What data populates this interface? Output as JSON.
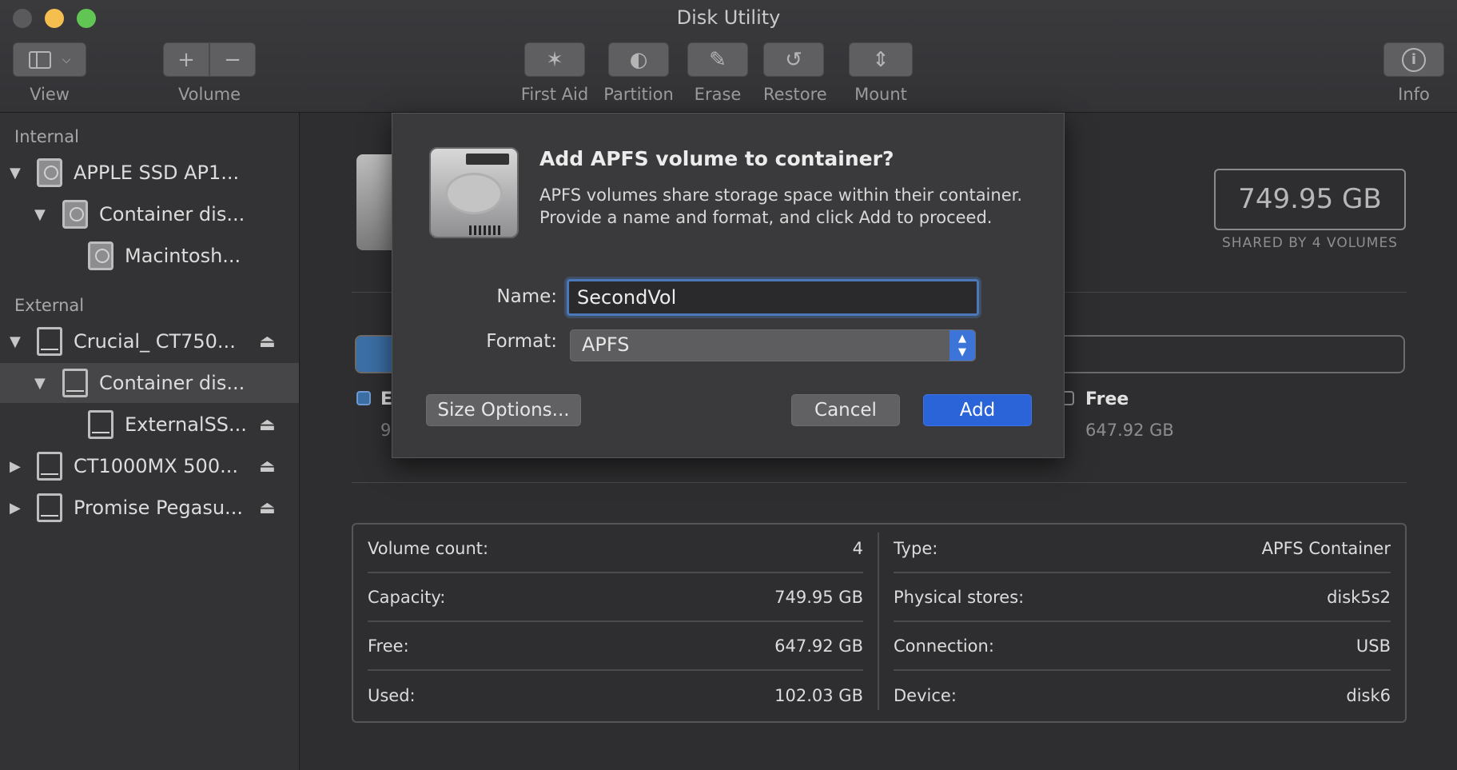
{
  "window": {
    "title": "Disk Utility"
  },
  "toolbar": {
    "view_label": "View",
    "volume_label": "Volume",
    "first_aid_label": "First Aid",
    "partition_label": "Partition",
    "erase_label": "Erase",
    "restore_label": "Restore",
    "mount_label": "Mount",
    "info_label": "Info"
  },
  "sidebar": {
    "internal_header": "Internal",
    "external_header": "External",
    "items": [
      {
        "label": "APPLE SSD AP1..."
      },
      {
        "label": "Container dis..."
      },
      {
        "label": "Macintosh..."
      },
      {
        "label": "Crucial_ CT750..."
      },
      {
        "label": "Container dis..."
      },
      {
        "label": "ExternalSS..."
      },
      {
        "label": "CT1000MX 500..."
      },
      {
        "label": "Promise Pegasu..."
      }
    ]
  },
  "main": {
    "capacity": "749.95 GB",
    "capacity_sub": "SHARED BY 4 VOLUMES",
    "used_fraction": 0.136,
    "legend_used_name": "E",
    "legend_used_value": "9",
    "legend_free_name": "Free",
    "legend_free_value": "647.92 GB",
    "info_left": [
      {
        "label": "Volume count:",
        "value": "4"
      },
      {
        "label": "Capacity:",
        "value": "749.95 GB"
      },
      {
        "label": "Free:",
        "value": "647.92 GB"
      },
      {
        "label": "Used:",
        "value": "102.03 GB"
      }
    ],
    "info_right": [
      {
        "label": "Type:",
        "value": "APFS Container"
      },
      {
        "label": "Physical stores:",
        "value": "disk5s2"
      },
      {
        "label": "Connection:",
        "value": "USB"
      },
      {
        "label": "Device:",
        "value": "disk6"
      }
    ]
  },
  "dialog": {
    "title": "Add APFS volume to container?",
    "body": "APFS volumes share storage space within their container. Provide a name and format, and click Add to proceed.",
    "name_label": "Name:",
    "name_value": "SecondVol",
    "format_label": "Format:",
    "format_value": "APFS",
    "size_options_label": "Size Options...",
    "cancel_label": "Cancel",
    "add_label": "Add"
  },
  "colors": {
    "accent": "#2b63d9",
    "used_bar": "#3c6fa6"
  }
}
